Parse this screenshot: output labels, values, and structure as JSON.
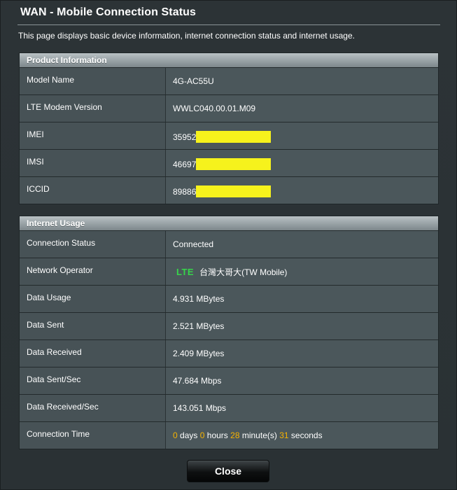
{
  "page": {
    "title": "WAN - Mobile Connection Status",
    "description": "This page displays basic device information, internet connection status and internet usage."
  },
  "product_info": {
    "header": "Product Information",
    "rows": [
      {
        "label": "Model Name",
        "value": "4G-AC55U"
      },
      {
        "label": "LTE Modem Version",
        "value": "WWLC040.00.01.M09"
      },
      {
        "label": "IMEI",
        "value": "35952"
      },
      {
        "label": "IMSI",
        "value": "46697"
      },
      {
        "label": "ICCID",
        "value": "89886"
      }
    ]
  },
  "internet_usage": {
    "header": "Internet Usage",
    "connection_status": {
      "label": "Connection Status",
      "value": "Connected"
    },
    "network_operator": {
      "label": "Network Operator",
      "badge": "LTE",
      "value": "台灣大哥大(TW Mobile)"
    },
    "data_usage": {
      "label": "Data Usage",
      "value": "4.931 MBytes"
    },
    "data_sent": {
      "label": "Data Sent",
      "value": "2.521 MBytes"
    },
    "data_received": {
      "label": "Data Received",
      "value": "2.409 MBytes"
    },
    "data_sent_sec": {
      "label": "Data Sent/Sec",
      "value": "47.684 Mbps"
    },
    "data_received_sec": {
      "label": "Data Received/Sec",
      "value": "143.051 Mbps"
    },
    "connection_time": {
      "label": "Connection Time",
      "days": "0",
      "days_unit": "days",
      "hours": "0",
      "hours_unit": "hours",
      "minutes": "28",
      "minutes_unit": "minute(s)",
      "seconds": "31",
      "seconds_unit": "seconds"
    }
  },
  "buttons": {
    "close": "Close"
  },
  "colors": {
    "redaction": "#f6f21c",
    "lte_badge": "#36d54a",
    "time_numbers": "#f7b300"
  }
}
